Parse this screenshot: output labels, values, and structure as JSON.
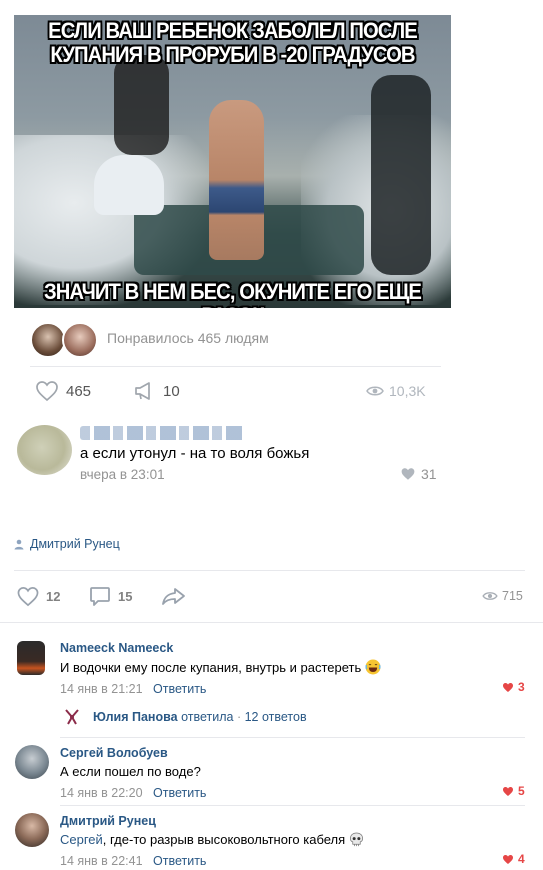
{
  "meme": {
    "top_line1": "ЕСЛИ ВАШ РЕБЕНОК ЗАБОЛЕЛ ПОСЛЕ",
    "top_line2": "КУПАНИЯ В ПРОРУБИ В -20 ГРАДУСОВ",
    "bottom_line": "ЗНАЧИТ В НЕМ БЕС, ОКУНИТЕ ЕГО ЕЩЕ РАЗОК"
  },
  "liked_by": {
    "text": "Понравилось 465 людям"
  },
  "inner_post": {
    "likes": "465",
    "reposts": "10",
    "views": "10,3K"
  },
  "inner_comment": {
    "text": "а если утонул - на то воля божья",
    "time": "вчера в 23:01",
    "likes": "31"
  },
  "author": {
    "name": "Дмитрий Рунец"
  },
  "post_actions": {
    "likes": "12",
    "comments": "15",
    "views": "715"
  },
  "comments": [
    {
      "name": "Nameeck Nameeck",
      "text": "И водочки ему после купания, внутрь и растереть",
      "time": "14 янв в 21:21",
      "reply": "Ответить",
      "likes": "3",
      "thread": {
        "name": "Юлия Панова",
        "action": "ответила",
        "dot": "·",
        "count": "12 ответов"
      }
    },
    {
      "name": "Сергей Волобуев",
      "text": "А если пошел по воде?",
      "time": "14 янв в 22:20",
      "reply": "Ответить",
      "likes": "5"
    },
    {
      "name": "Дмитрий Рунец",
      "mention": "Сергей",
      "text": ", где-то разрыв высоковольтного кабеля",
      "time": "14 янв в 22:41",
      "reply": "Ответить",
      "likes": "4"
    }
  ],
  "colors": {
    "link": "#2a5885",
    "meta": "#939393",
    "heart": "#e64646",
    "separator": "#e7e8ec"
  },
  "icons": [
    "heart-icon",
    "megaphone-icon",
    "eye-icon",
    "user-icon",
    "comment-icon",
    "share-icon",
    "laugh-emoji-icon",
    "skull-emoji-icon"
  ]
}
